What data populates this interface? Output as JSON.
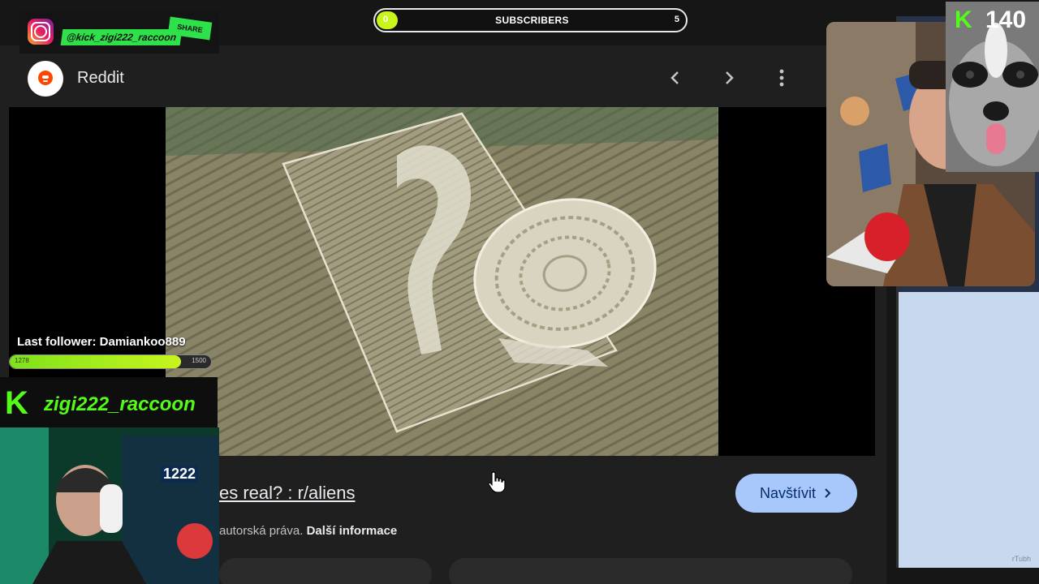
{
  "viewer": {
    "site_name": "Reddit",
    "prev_icon": "chevron-left-icon",
    "next_icon": "chevron-right-icon",
    "more_icon": "more-vert-icon",
    "caption_title": "es real? : r/aliens",
    "visit_label": "Navštívit",
    "visit_icon": "chevron-right-icon",
    "copyright_text": "autorská práva.",
    "more_info_label": "Další informace"
  },
  "overlay": {
    "instagram_handle": "@kick_zigi222_raccoon",
    "share_label": "SHARE",
    "subscribers": {
      "label": "SUBSCRIBERS",
      "current": "0",
      "goal": "5",
      "progress_fraction": 0
    },
    "kick_viewers": "140",
    "last_follower": "Last follower: Damiankoo889",
    "follower_goal": {
      "current": "1278",
      "goal": "1500",
      "progress_fraction": 0.85
    },
    "kick_name": "zigi222_raccoon",
    "led_display": "1222"
  },
  "colors": {
    "kick_green": "#53fc18",
    "visit_button": "#a8c7fa",
    "viewer_bg": "#1f1f1f"
  }
}
